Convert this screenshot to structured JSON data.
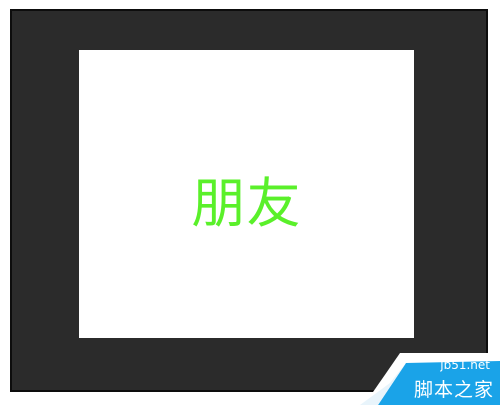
{
  "document": {
    "text": "朋友",
    "text_color": "#5af02a"
  },
  "watermark": {
    "url": "jb51.net",
    "name": "脚本之家",
    "color": "#1aa3e8"
  }
}
